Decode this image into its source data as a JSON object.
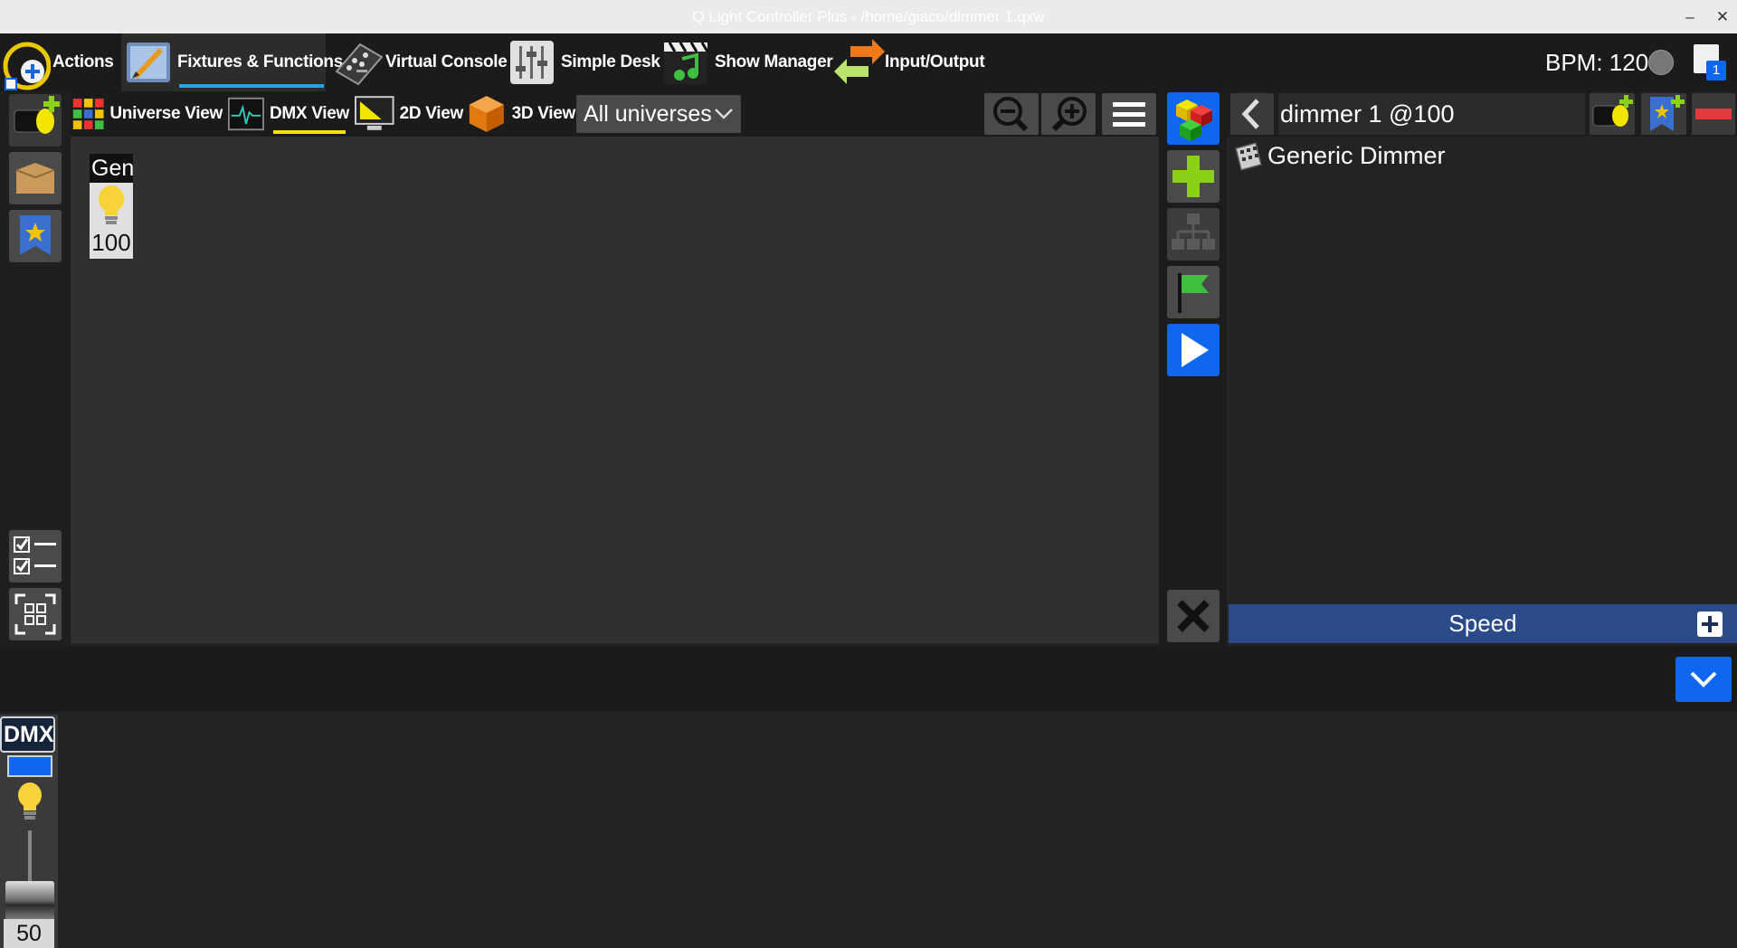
{
  "window": {
    "title": "Q Light Controller Plus - /home/giaco/dimmer 1.qxw",
    "minimize_glyph": "–",
    "close_glyph": "✕"
  },
  "menu": {
    "items": [
      {
        "label": "Actions",
        "icon": "actions-icon"
      },
      {
        "label": "Fixtures & Functions",
        "icon": "fixtures-functions-icon",
        "selected": true
      },
      {
        "label": "Virtual Console",
        "icon": "virtual-console-icon"
      },
      {
        "label": "Simple Desk",
        "icon": "simple-desk-icon"
      },
      {
        "label": "Show Manager",
        "icon": "show-manager-icon"
      },
      {
        "label": "Input/Output",
        "icon": "input-output-icon"
      }
    ],
    "bpm_label": "BPM: 120",
    "page_badge": "1"
  },
  "left_toolbar": {
    "buttons": [
      "add-fixture-icon",
      "fixture-groups-icon",
      "palettes-icon",
      "checklist-icon",
      "select-all-icon"
    ]
  },
  "fixture_views": {
    "tabs": [
      {
        "label": "Universe View",
        "icon": "universe-view-icon"
      },
      {
        "label": "DMX View",
        "icon": "dmx-view-icon",
        "selected": true
      },
      {
        "label": "2D View",
        "icon": "2d-view-icon"
      },
      {
        "label": "3D View",
        "icon": "3d-view-icon"
      }
    ],
    "universe_filter": "All universes",
    "tools": [
      "zoom-out-icon",
      "zoom-in-icon",
      "menu-icon"
    ]
  },
  "dmx_view": {
    "fixture": {
      "name": "Gene",
      "value": "100",
      "icon": "bulb-icon"
    }
  },
  "function_toolbar": {
    "buttons": [
      "function-manager-icon",
      "add-function-icon",
      "function-tree-icon",
      "flag-icon",
      "play-icon",
      "close-icon"
    ]
  },
  "right_panel": {
    "title": "dimmer 1 @100",
    "entry": "Generic Dimmer",
    "speed_label": "Speed",
    "colors": {
      "speed_bar": "#2a4a8a",
      "accent_blue": "#0f67f0"
    }
  },
  "bottom": {
    "channel": {
      "label": "DMX",
      "value": "50",
      "level_fraction": 0.2,
      "color": "#0f67f0"
    }
  }
}
